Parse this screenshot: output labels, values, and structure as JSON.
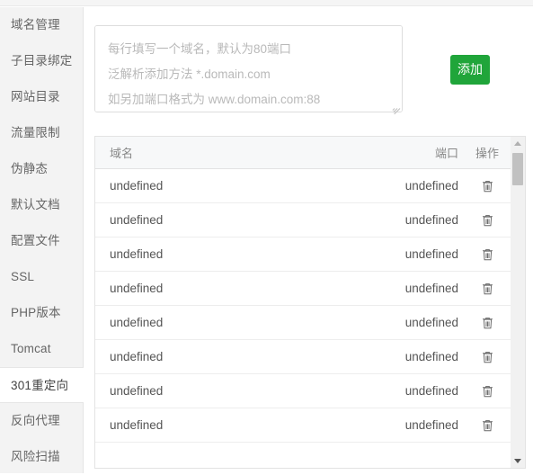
{
  "sidebar": {
    "items": [
      {
        "label": "域名管理",
        "active": false
      },
      {
        "label": "子目录绑定",
        "active": false
      },
      {
        "label": "网站目录",
        "active": false
      },
      {
        "label": "流量限制",
        "active": false
      },
      {
        "label": "伪静态",
        "active": false
      },
      {
        "label": "默认文档",
        "active": false
      },
      {
        "label": "配置文件",
        "active": false
      },
      {
        "label": "SSL",
        "active": false
      },
      {
        "label": "PHP版本",
        "active": false
      },
      {
        "label": "Tomcat",
        "active": false
      },
      {
        "label": "301重定向",
        "active": true
      },
      {
        "label": "反向代理",
        "active": false
      },
      {
        "label": "风险扫描",
        "active": false
      }
    ]
  },
  "add_form": {
    "textarea": {
      "value": "",
      "placeholder": "每行填写一个域名，默认为80端口\n泛解析添加方法 *.domain.com\n如另加端口格式为 www.domain.com:88"
    },
    "add_button_label": "添加"
  },
  "table": {
    "headers": {
      "domain": "域名",
      "port": "端口",
      "operation": "操作"
    },
    "delete_icon": "trash-icon",
    "rows": [
      {
        "domain": "undefined",
        "port": "undefined"
      },
      {
        "domain": "undefined",
        "port": "undefined"
      },
      {
        "domain": "undefined",
        "port": "undefined"
      },
      {
        "domain": "undefined",
        "port": "undefined"
      },
      {
        "domain": "undefined",
        "port": "undefined"
      },
      {
        "domain": "undefined",
        "port": "undefined"
      },
      {
        "domain": "undefined",
        "port": "undefined"
      },
      {
        "domain": "undefined",
        "port": "undefined"
      },
      {
        "domain": "",
        "port": ""
      }
    ]
  },
  "scrollbar": {
    "up_icon": "caret-up-icon",
    "down_icon": "caret-down-icon",
    "thumb": "scroll-thumb"
  },
  "colors": {
    "accent_green": "#20a53a",
    "sidebar_bg": "#f3f3f3",
    "header_bg": "#f7f8f9",
    "border": "#e3e3e3",
    "text": "#555555",
    "muted": "#b9b9b9"
  }
}
